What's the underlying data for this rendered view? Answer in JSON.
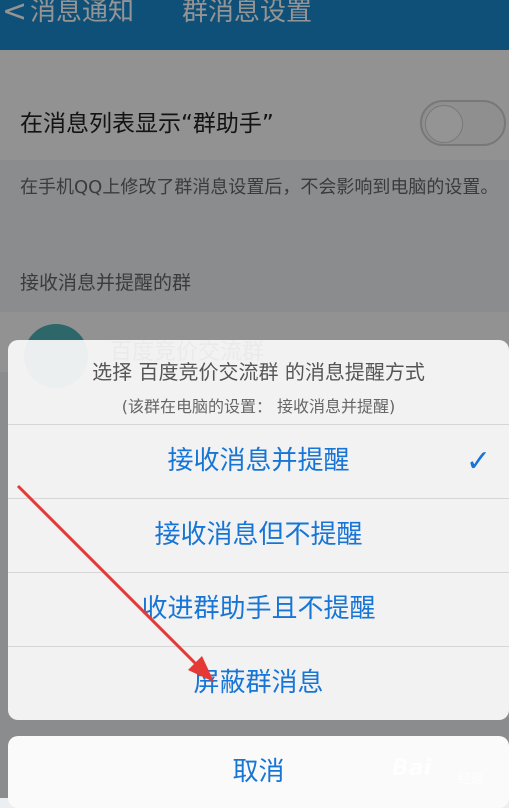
{
  "header": {
    "back_label": "消息通知",
    "title": "群消息设置"
  },
  "settings": {
    "toggle_label": "在消息列表显示“群助手”",
    "description": "在手机QQ上修改了群消息设置后，不会影响到电脑的设置。",
    "section_title": "接收消息并提醒的群",
    "group_name": "百度竞价交流群"
  },
  "sheet": {
    "title": "选择 百度竞价交流群 的消息提醒方式",
    "subtitle": "(该群在电脑的设置： 接收消息并提醒)",
    "options": [
      {
        "label": "接收消息并提醒",
        "selected": true
      },
      {
        "label": "接收消息但不提醒",
        "selected": false
      },
      {
        "label": "收进群助手且不提醒",
        "selected": false
      },
      {
        "label": "屏蔽群消息",
        "selected": false
      }
    ],
    "cancel_label": "取消"
  },
  "watermark": {
    "main": "Bai",
    "sub": "经验"
  },
  "colors": {
    "header_bg": "#1b8bd0",
    "accent": "#1775d6",
    "arrow": "#e53935"
  }
}
